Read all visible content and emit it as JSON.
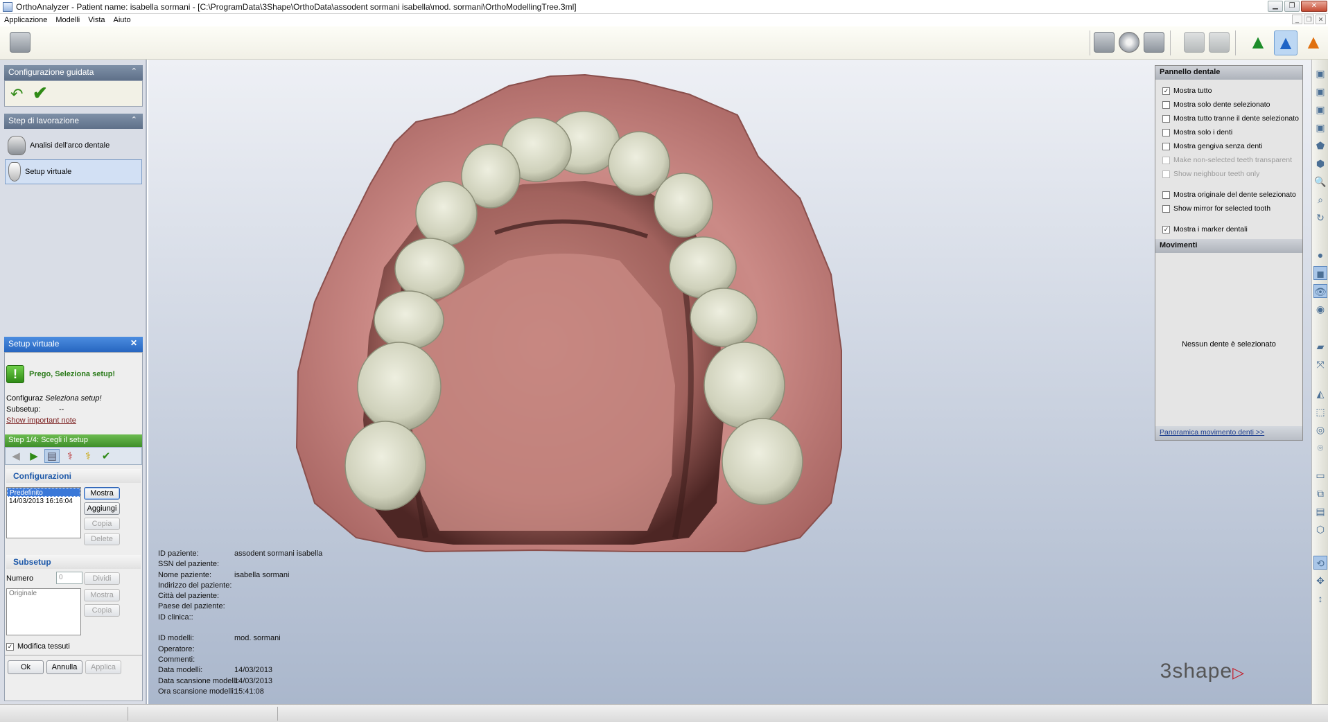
{
  "window": {
    "title": "OrthoAnalyzer - Patient name: isabella sormani - [C:\\ProgramData\\3Shape\\OrthoData\\assodent sormani  isabella\\mod. sormani\\OrthoModellingTree.3ml]"
  },
  "menu": [
    "Applicazione",
    "Modelli",
    "Vista",
    "Aiuto"
  ],
  "left": {
    "guided_header": "Configurazione guidata",
    "work_header": "Step di lavorazione",
    "work_items": [
      "Analisi dell'arco dentale",
      "Setup virtuale"
    ],
    "vsetup_header": "Setup virtuale",
    "vsetup_message": "Prego, Seleziona setup!",
    "configuraz_label": "Configuraz",
    "configuraz_value": "Seleziona setup!",
    "subsetup_label": "Subsetup:",
    "subsetup_value": "--",
    "important_link": "Show important note",
    "step_title": "Step 1/4: Scegli il setup",
    "config_header": "Configurazioni",
    "config_list": [
      "Predefinito",
      "14/03/2013  16:16:04"
    ],
    "btn_mostra": "Mostra",
    "btn_aggiungi": "Aggiungi",
    "btn_copia": "Copia",
    "btn_delete": "Delete",
    "subsetup_header": "Subsetup",
    "numero_label": "Numero",
    "numero_value": "0",
    "btn_dividi": "Dividi",
    "subsetup_list": [
      "Originale"
    ],
    "btn_mostra2": "Mostra",
    "btn_copia2": "Copia",
    "modifica_tessuti": "Modifica tessuti",
    "btn_ok": "Ok",
    "btn_annulla": "Annulla",
    "btn_applica": "Applica"
  },
  "patient_info": [
    {
      "k": "ID paziente:",
      "v": "assodent sormani  isabella"
    },
    {
      "k": "SSN del paziente:",
      "v": ""
    },
    {
      "k": "Nome paziente:",
      "v": "isabella sormani"
    },
    {
      "k": "Indirizzo del paziente:",
      "v": ""
    },
    {
      "k": "Città del paziente:",
      "v": ""
    },
    {
      "k": "Paese del paziente:",
      "v": ""
    },
    {
      "k": "ID clinica::",
      "v": ""
    },
    {
      "k": "",
      "v": ""
    },
    {
      "k": "ID modelli:",
      "v": "mod. sormani"
    },
    {
      "k": "Operatore:",
      "v": ""
    },
    {
      "k": "Commenti:",
      "v": ""
    },
    {
      "k": "Data modelli:",
      "v": "14/03/2013"
    },
    {
      "k": "Data scansione modelli:",
      "v": "14/03/2013"
    },
    {
      "k": "Ora scansione modelli:",
      "v": "15:41:08"
    }
  ],
  "logo": "3shape",
  "right_panel": {
    "header": "Pannello dentale",
    "options": [
      {
        "label": "Mostra tutto",
        "checked": true,
        "dim": false
      },
      {
        "label": "Mostra solo dente selezionato",
        "checked": false,
        "dim": false
      },
      {
        "label": "Mostra tutto tranne il dente selezionato",
        "checked": false,
        "dim": false
      },
      {
        "label": "Mostra solo i denti",
        "checked": false,
        "dim": false
      },
      {
        "label": "Mostra gengiva senza denti",
        "checked": false,
        "dim": false
      },
      {
        "label": "Make non-selected teeth transparent",
        "checked": false,
        "dim": true
      },
      {
        "label": "Show neighbour teeth only",
        "checked": false,
        "dim": true
      },
      {
        "label": "Mostra originale del dente selezionato",
        "checked": false,
        "dim": false
      },
      {
        "label": "Show mirror for selected tooth",
        "checked": false,
        "dim": false
      },
      {
        "label": "Mostra i marker dentali",
        "checked": true,
        "dim": false
      }
    ],
    "movements_header": "Movimenti",
    "no_selection": "Nessun dente è selezionato",
    "overview_link": "Panoramica movimento denti >>"
  },
  "colors": {
    "gum": "#c98581",
    "tooth": "#d7d8c6",
    "accent": "#2766c0",
    "step_green": "#4f9e38"
  }
}
